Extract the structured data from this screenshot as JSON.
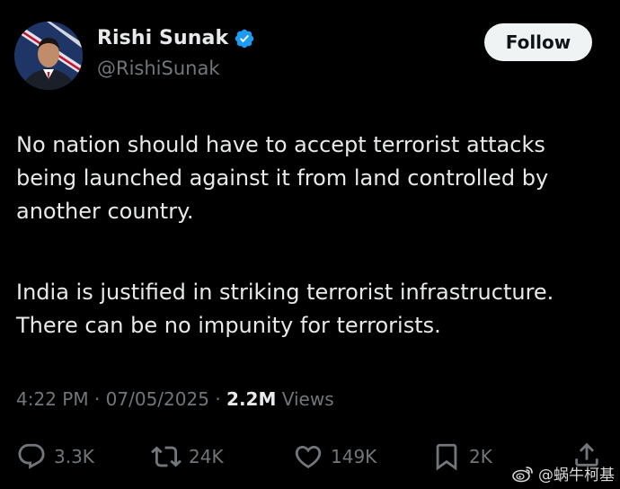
{
  "author": {
    "display_name": "Rishi Sunak",
    "handle": "@RishiSunak",
    "verified_icon": "verified-badge-icon"
  },
  "follow_button": {
    "label": "Follow"
  },
  "tweet": {
    "paragraph1": [
      "No nation should have to accept terrorist attacks",
      "being launched against it from land controlled by",
      "another country."
    ],
    "paragraph2": [
      "India is justified in striking terrorist infrastructure.",
      "There can be no impunity for terrorists."
    ]
  },
  "meta": {
    "time": "4:22 PM",
    "separator": "·",
    "date": "07/05/2025",
    "views_count": "2.2M",
    "views_label": "Views"
  },
  "actions": {
    "replies": "3.3K",
    "reposts": "24K",
    "likes": "149K",
    "bookmarks": "2K"
  },
  "watermark": {
    "text": "@蜗牛柯基"
  },
  "colors": {
    "background": "#000000",
    "primary_text": "#e7e9ea",
    "secondary_text": "#71767b",
    "verified_blue": "#1d9bf0",
    "follow_bg": "#eff3f4"
  }
}
